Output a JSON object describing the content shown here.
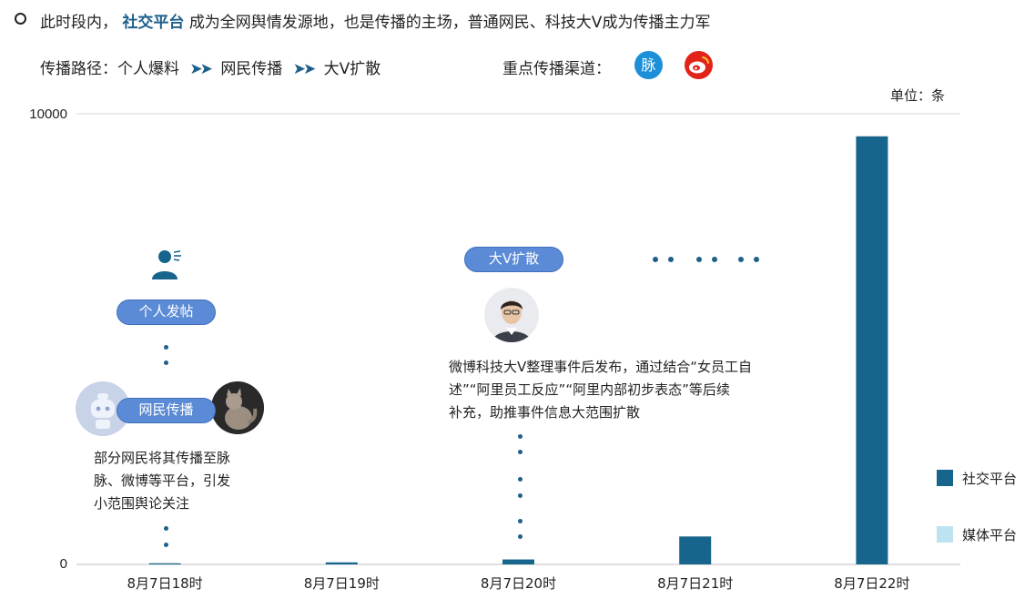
{
  "header": {
    "headline_prefix": "此时段内，",
    "headline_highlight": "社交平台",
    "headline_suffix": "成为全网舆情发源地，也是传播的主场，普通网民、科技大V成为传播主力军",
    "path_label": "传播路径：",
    "path_steps": [
      "个人爆料",
      "网民传播",
      "大V扩散"
    ],
    "path_arrow": "➤➤",
    "channel_label": "重点传播渠道：",
    "maimai_glyph": "脉"
  },
  "unit_label": "单位：条",
  "annotations": {
    "pill_personal": "个人发帖",
    "pill_netizen": "网民传播",
    "pill_bigv": "大V扩散",
    "netizen_note": [
      "部分网民将其传播至脉",
      "脉、微博等平台，引发",
      "小范围舆论关注"
    ],
    "bigv_note": [
      "微博科技大V整理事件后发布，通过结合“女员工自",
      "述”“阿里员工反应”“阿里内部初步表态”等后续",
      "补充，助推事件信息大范围扩散"
    ]
  },
  "chart_data": {
    "type": "bar",
    "categories": [
      "8月7日18时",
      "8月7日19时",
      "8月7日20时",
      "8月7日21时",
      "8月7日22时"
    ],
    "series": [
      {
        "name": "社交平台",
        "values": [
          25,
          45,
          110,
          620,
          9500
        ],
        "color": "#17648c"
      },
      {
        "name": "媒体平台",
        "values": [
          0,
          0,
          0,
          0,
          0
        ],
        "color": "#bde3f2"
      }
    ],
    "y_tick_labels": [
      "0",
      "10000"
    ],
    "ylim": [
      0,
      10000
    ],
    "legend_position": "right",
    "grid": false
  }
}
